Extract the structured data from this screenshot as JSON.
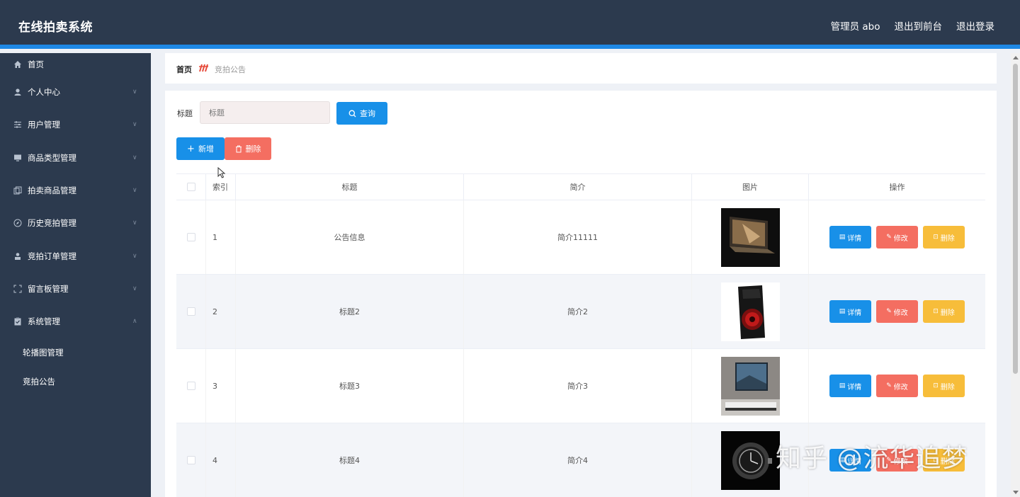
{
  "header": {
    "app_title": "在线拍卖系统",
    "admin_label": "管理员 abo",
    "exit_front_label": "退出到前台",
    "logout_label": "退出登录"
  },
  "sidebar": {
    "items": [
      {
        "label": "首页",
        "icon": "home-icon"
      },
      {
        "label": "个人中心",
        "icon": "user-icon"
      },
      {
        "label": "用户管理",
        "icon": "sliders-icon"
      },
      {
        "label": "商品类型管理",
        "icon": "monitor-icon"
      },
      {
        "label": "拍卖商品管理",
        "icon": "copy-icon"
      },
      {
        "label": "历史竞拍管理",
        "icon": "compass-icon"
      },
      {
        "label": "竞拍订单管理",
        "icon": "person-icon"
      },
      {
        "label": "留言板管理",
        "icon": "frame-icon"
      },
      {
        "label": "系统管理",
        "icon": "clipboard-icon"
      }
    ],
    "sub_items": [
      {
        "label": "轮播图管理"
      },
      {
        "label": "竞拍公告"
      }
    ]
  },
  "breadcrumb": {
    "home": "首页",
    "current": "竞拍公告"
  },
  "search": {
    "label": "标题",
    "placeholder": "标题",
    "query_button": "查询"
  },
  "toolbar": {
    "add_label": "新增",
    "delete_label": "删除"
  },
  "table": {
    "headers": {
      "index": "索引",
      "title": "标题",
      "intro": "简介",
      "image": "图片",
      "ops": "操作"
    },
    "rows": [
      {
        "index": "1",
        "title": "公告信息",
        "intro": "简介11111",
        "image": "laptop"
      },
      {
        "index": "2",
        "title": "标题2",
        "intro": "简介2",
        "image": "pc-case"
      },
      {
        "index": "3",
        "title": "标题3",
        "intro": "简介3",
        "image": "tv-room"
      },
      {
        "index": "4",
        "title": "标题4",
        "intro": "简介4",
        "image": "watch"
      }
    ],
    "op_labels": {
      "detail": "详情",
      "edit": "修改",
      "remove": "删除"
    }
  },
  "watermark": "知乎 @流华追梦",
  "colors": {
    "header_bg": "#2c3a4e",
    "accent": "#1e88e5",
    "primary_button": "#1890e8",
    "danger_button": "#f46e61",
    "warning_button": "#f7bd3a"
  }
}
